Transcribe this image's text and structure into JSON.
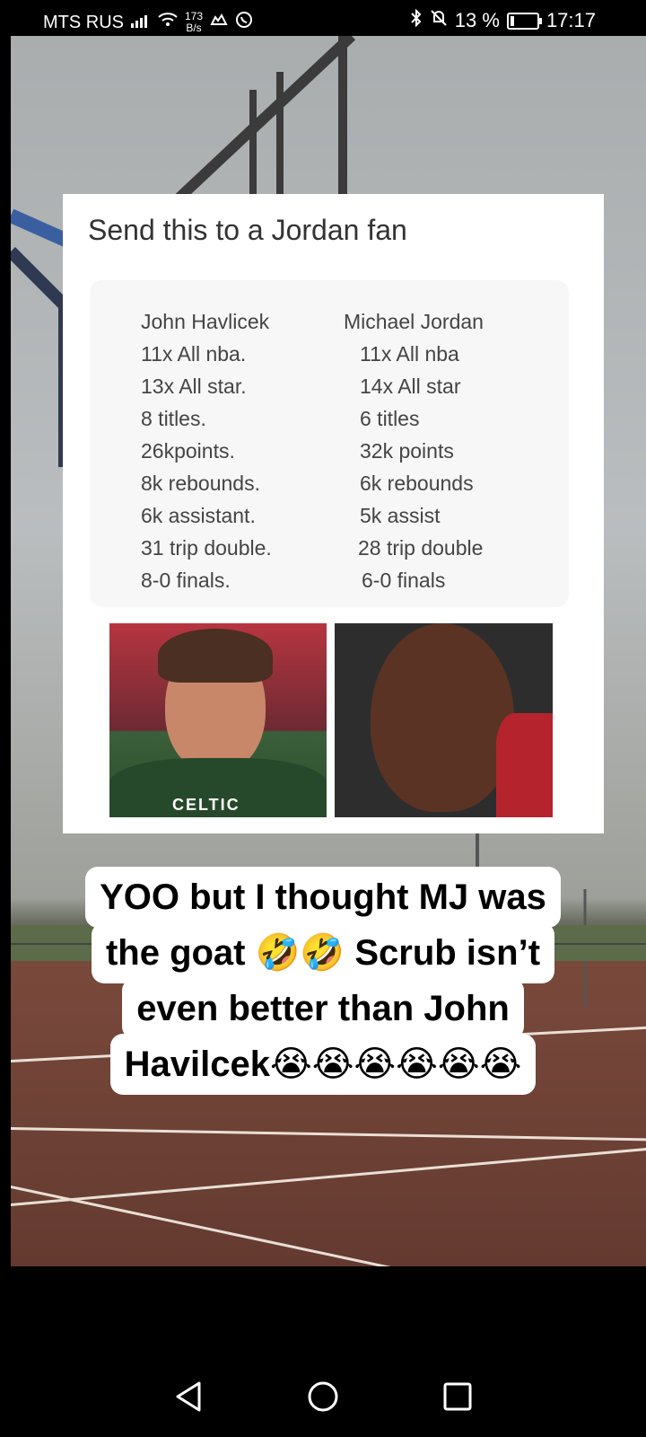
{
  "status_bar": {
    "carrier": "MTS RUS",
    "speed_value": "173",
    "speed_unit": "B/s",
    "battery": "13 %",
    "battery_level": 0.13,
    "time": "17:17"
  },
  "post": {
    "title": "Send this to a Jordan fan",
    "left_column": {
      "header": "John Havlicek",
      "rows": [
        "11x All nba.",
        "13x All star.",
        "8 titles.",
        "26kpoints.",
        "8k rebounds.",
        "6k assistant.",
        "31 trip double.",
        "8-0 finals."
      ]
    },
    "right_column": {
      "header": "Michael Jordan",
      "rows": [
        "11x All nba",
        "14x All star",
        "6 titles",
        "32k points",
        "6k rebounds",
        "5k assist",
        "28 trip double",
        "6-0 finals"
      ]
    },
    "photo_jersey_text": "CELTIC"
  },
  "caption": {
    "lines": [
      "YOO but I thought MJ was",
      "the goat 🤣🤣 Scrub isn’t",
      "even better than John",
      "Havilcek😭😭😭😭😭😭"
    ]
  },
  "nav": {
    "back_icon": "back-triangle-icon",
    "home_icon": "home-circle-icon",
    "recents_icon": "recents-square-icon"
  }
}
